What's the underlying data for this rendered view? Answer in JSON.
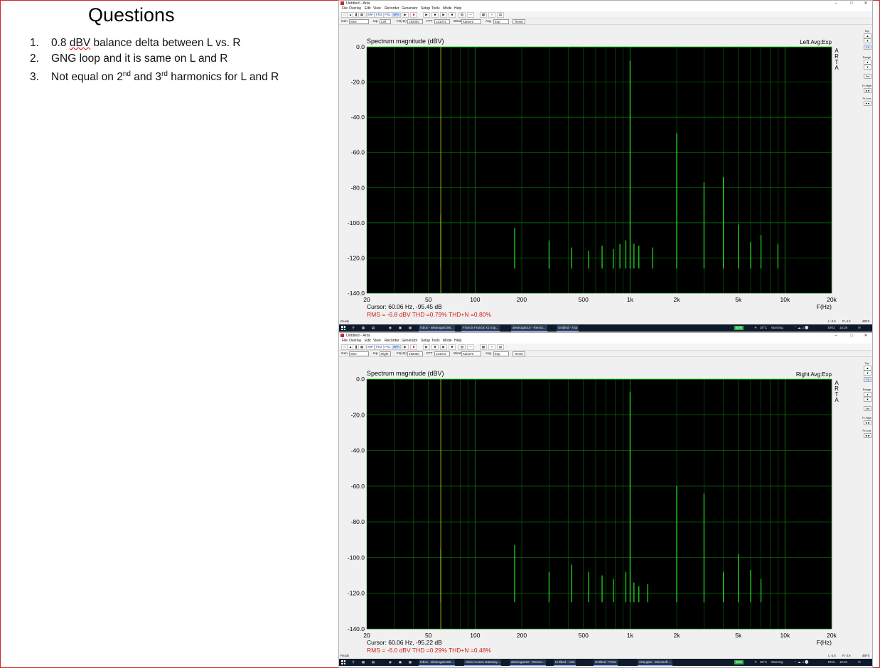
{
  "slide": {
    "title": "Questions",
    "items": [
      {
        "num": "1.",
        "text_a": "0.8 ",
        "text_b": "dBV",
        "text_c": " balance delta between  L vs. R"
      },
      {
        "num": "2.",
        "text": "GNG loop and it is same on L and R"
      },
      {
        "num": "3.",
        "pre": "Not equal on 2",
        "sup1": "nd",
        "mid": " and 3",
        "sup2": "rd",
        "post": " harmonics for L and R"
      }
    ]
  },
  "windows": [
    {
      "title": "Untitled - Arta",
      "menu": [
        "File",
        "Overlay",
        "Edit",
        "View",
        "Recorder",
        "Generator",
        "Setup",
        "Tools",
        "Mode",
        "Help"
      ],
      "toolbar": [
        "IMP",
        "FR2",
        "FR1",
        "SPA"
      ],
      "gen_label": "Gen",
      "gen_value": "Sine",
      "inp_label": "Inp",
      "inp_value": "Left",
      "fs_label": "Fs(Hz)",
      "fs_value": "192000",
      "fft_label": "FFT",
      "fft_value": "131072",
      "wind_label": "Wind",
      "wind_value": "Kaiser5",
      "avg_label": "Avg",
      "avg_value": "Exp",
      "reset": "Reset",
      "side": {
        "top": "Top",
        "fit": "Fit",
        "range": "Range",
        "set": "Set",
        "frhigh": "Fr.High",
        "frlow": "Fr.Low"
      },
      "status_left": "Ready",
      "status_mid": "L:-3.6",
      "status_mid2": "R:-4.0",
      "status_right": "dBFS",
      "taskbar": [
        {
          "label": "Inbox - alexkogan196...",
          "x": 112
        },
        {
          "label": "Francis Francis X1 Esp...",
          "x": 172
        },
        {
          "label": "alexkogan10 - Remot...",
          "x": 242
        },
        {
          "label": "Untitled - Arta",
          "x": 306
        }
      ],
      "battery": "92%",
      "temp": "38°C",
      "warning": "Warning",
      "lang": "ENG",
      "time": "15:36"
    },
    {
      "title": "Untitled - Arta",
      "menu": [
        "File",
        "Overlay",
        "Edit",
        "View",
        "Recorder",
        "Generator",
        "Setup",
        "Tools",
        "Mode",
        "Help"
      ],
      "toolbar": [
        "IMP",
        "FR2",
        "FR1",
        "SPA"
      ],
      "gen_label": "Gen",
      "gen_value": "Sine",
      "inp_label": "Inp",
      "inp_value": "Right",
      "fs_label": "Fs(Hz)",
      "fs_value": "192000",
      "fft_label": "FFT",
      "fft_value": "131072",
      "wind_label": "Wind",
      "wind_value": "Kaiser5",
      "avg_label": "Avg",
      "avg_value": "Exp",
      "reset": "Reset",
      "side": {
        "top": "Top",
        "fit": "Fit",
        "range": "Range",
        "set": "Set",
        "frhigh": "Fr.High",
        "frlow": "Fr.Low"
      },
      "status_left": "Ready",
      "status_mid": "L:-3.6",
      "status_mid2": "R:-3.9",
      "status_right": "dBFS",
      "taskbar": [
        {
          "label": "Inbox - alexkogan196...",
          "x": 112
        },
        {
          "label": "Citrix Access Gateway...",
          "x": 176
        },
        {
          "label": "alexkogan10 - Remot...",
          "x": 240
        },
        {
          "label": "Untitled - Arta",
          "x": 302
        },
        {
          "label": "Untitled - Paint",
          "x": 358
        },
        {
          "label": "Arta.pptx - Microsoft ...",
          "x": 420
        }
      ],
      "battery": "92%",
      "temp": "38°C",
      "warning": "Warning",
      "lang": "ENG",
      "time": "16:01"
    }
  ],
  "chart_data": [
    {
      "type": "line",
      "title": "Spectrum magnitude (dBV)",
      "channel_label": "Left  Avg:Exp",
      "arta": "A R T A",
      "xlabel": "F(Hz)",
      "xscale": "log",
      "xlim": [
        20,
        20000
      ],
      "ylim": [
        -140,
        0
      ],
      "yticks": [
        "0.0",
        "-20.0",
        "-40.0",
        "-60.0",
        "-80.0",
        "-100.0",
        "-120.0",
        "-140.0"
      ],
      "xticks": [
        "20",
        "50",
        "100",
        "200",
        "500",
        "1k",
        "2k",
        "5k",
        "10k",
        "20k"
      ],
      "grid": true,
      "noise_floor": -126,
      "peaks": [
        {
          "f": 60,
          "db": -95.5,
          "w": 0.018
        },
        {
          "f": 180,
          "db": -103,
          "w": 0.0015
        },
        {
          "f": 300,
          "db": -110,
          "w": 0.001
        },
        {
          "f": 420,
          "db": -114,
          "w": 0.001
        },
        {
          "f": 540,
          "db": -116,
          "w": 0.001
        },
        {
          "f": 660,
          "db": -113,
          "w": 0.001
        },
        {
          "f": 780,
          "db": -115,
          "w": 0.001
        },
        {
          "f": 860,
          "db": -112,
          "w": 0.001
        },
        {
          "f": 940,
          "db": -110,
          "w": 0.001
        },
        {
          "f": 1000,
          "db": -8,
          "w": 0.0006
        },
        {
          "f": 1060,
          "db": -112,
          "w": 0.001
        },
        {
          "f": 1140,
          "db": -113,
          "w": 0.001
        },
        {
          "f": 1400,
          "db": -114,
          "w": 0.001
        },
        {
          "f": 2000,
          "db": -49,
          "w": 0.0006
        },
        {
          "f": 3000,
          "db": -77,
          "w": 0.0006
        },
        {
          "f": 4000,
          "db": -74,
          "w": 0.0006
        },
        {
          "f": 5000,
          "db": -101,
          "w": 0.0006
        },
        {
          "f": 6000,
          "db": -111,
          "w": 0.0006
        },
        {
          "f": 7000,
          "db": -107,
          "w": 0.0006
        },
        {
          "f": 9000,
          "db": -112,
          "w": 0.0006
        }
      ],
      "cursor_hz": 60.06,
      "cursor_text": "Cursor: 60.06 Hz, -95.45 dB",
      "rms_text": "RMS =   -6.8 dBV  THD =0.79%  THD+N =0.80%"
    },
    {
      "type": "line",
      "title": "Spectrum magnitude (dBV)",
      "channel_label": "Right  Avg:Exp",
      "arta": "A R T A",
      "xlabel": "F(Hz)",
      "xscale": "log",
      "xlim": [
        20,
        20000
      ],
      "ylim": [
        -140,
        0
      ],
      "yticks": [
        "0.0",
        "-20.0",
        "-40.0",
        "-60.0",
        "-80.0",
        "-100.0",
        "-120.0",
        "-140.0"
      ],
      "xticks": [
        "20",
        "50",
        "100",
        "200",
        "500",
        "1k",
        "2k",
        "5k",
        "10k",
        "20k"
      ],
      "grid": true,
      "noise_floor": -125,
      "peaks": [
        {
          "f": 60,
          "db": -95.2,
          "w": 0.018
        },
        {
          "f": 180,
          "db": -93,
          "w": 0.0015
        },
        {
          "f": 300,
          "db": -108,
          "w": 0.001
        },
        {
          "f": 420,
          "db": -104,
          "w": 0.001
        },
        {
          "f": 540,
          "db": -108,
          "w": 0.001
        },
        {
          "f": 660,
          "db": -110,
          "w": 0.001
        },
        {
          "f": 780,
          "db": -112,
          "w": 0.001
        },
        {
          "f": 940,
          "db": -108,
          "w": 0.001
        },
        {
          "f": 1000,
          "db": -7,
          "w": 0.0006
        },
        {
          "f": 1060,
          "db": -114,
          "w": 0.001
        },
        {
          "f": 1140,
          "db": -116,
          "w": 0.001
        },
        {
          "f": 1300,
          "db": -115,
          "w": 0.001
        },
        {
          "f": 2000,
          "db": -60,
          "w": 0.0006
        },
        {
          "f": 3000,
          "db": -64,
          "w": 0.0006
        },
        {
          "f": 4000,
          "db": -108,
          "w": 0.0006
        },
        {
          "f": 5000,
          "db": -98,
          "w": 0.0006
        },
        {
          "f": 6000,
          "db": -107,
          "w": 0.0006
        },
        {
          "f": 7000,
          "db": -112,
          "w": 0.0006
        }
      ],
      "cursor_hz": 60.06,
      "cursor_text": "Cursor: 60.06 Hz, -95.22 dB",
      "rms_text": "RMS =   -6.0 dBV  THD =0.29%  THD+N =0.48%"
    }
  ],
  "colors": {
    "trace": "#22ff22",
    "grid": "#0a7a0a",
    "cursor": "#b8b81e",
    "rms": "#d11a1a",
    "plot_bg": "#000000"
  }
}
